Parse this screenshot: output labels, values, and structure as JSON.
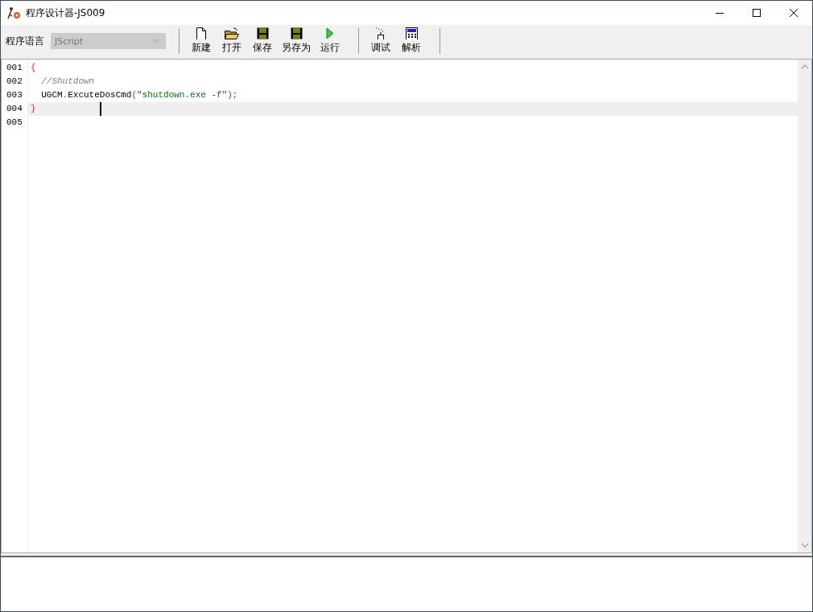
{
  "window": {
    "title": "程序设计器-JS009"
  },
  "toolbar": {
    "language_label": "程序语言",
    "language": {
      "value": "JScript",
      "disabled": true
    },
    "groups": [
      [
        {
          "label": "新建",
          "kind": "new"
        },
        {
          "label": "打开",
          "kind": "open"
        },
        {
          "label": "保存",
          "kind": "save"
        },
        {
          "label": "另存为",
          "kind": "saveas"
        },
        {
          "label": "运行",
          "kind": "run"
        }
      ],
      [
        {
          "label": "调试",
          "kind": "debug"
        },
        {
          "label": "解析",
          "kind": "parse"
        }
      ]
    ]
  },
  "editor": {
    "lines": [
      {
        "number": "001",
        "current": false,
        "tokens": [
          {
            "text": "{",
            "kind": "brace"
          }
        ]
      },
      {
        "number": "002",
        "current": false,
        "tokens": [
          {
            "text": "  //Shutdown",
            "kind": "comment"
          }
        ]
      },
      {
        "number": "003",
        "current": false,
        "tokens": [
          {
            "text": "  UGCM",
            "kind": "ident"
          },
          {
            "text": ".",
            "kind": "punct"
          },
          {
            "text": "ExcuteDosCmd",
            "kind": "ident"
          },
          {
            "text": "(",
            "kind": "punct"
          },
          {
            "text": "\"shutdown.exe -f\"",
            "kind": "string"
          },
          {
            "text": ");",
            "kind": "punct"
          }
        ]
      },
      {
        "number": "004",
        "current": true,
        "tokens": [
          {
            "text": "}",
            "kind": "brace"
          }
        ]
      },
      {
        "number": "005",
        "current": false
      }
    ]
  }
}
